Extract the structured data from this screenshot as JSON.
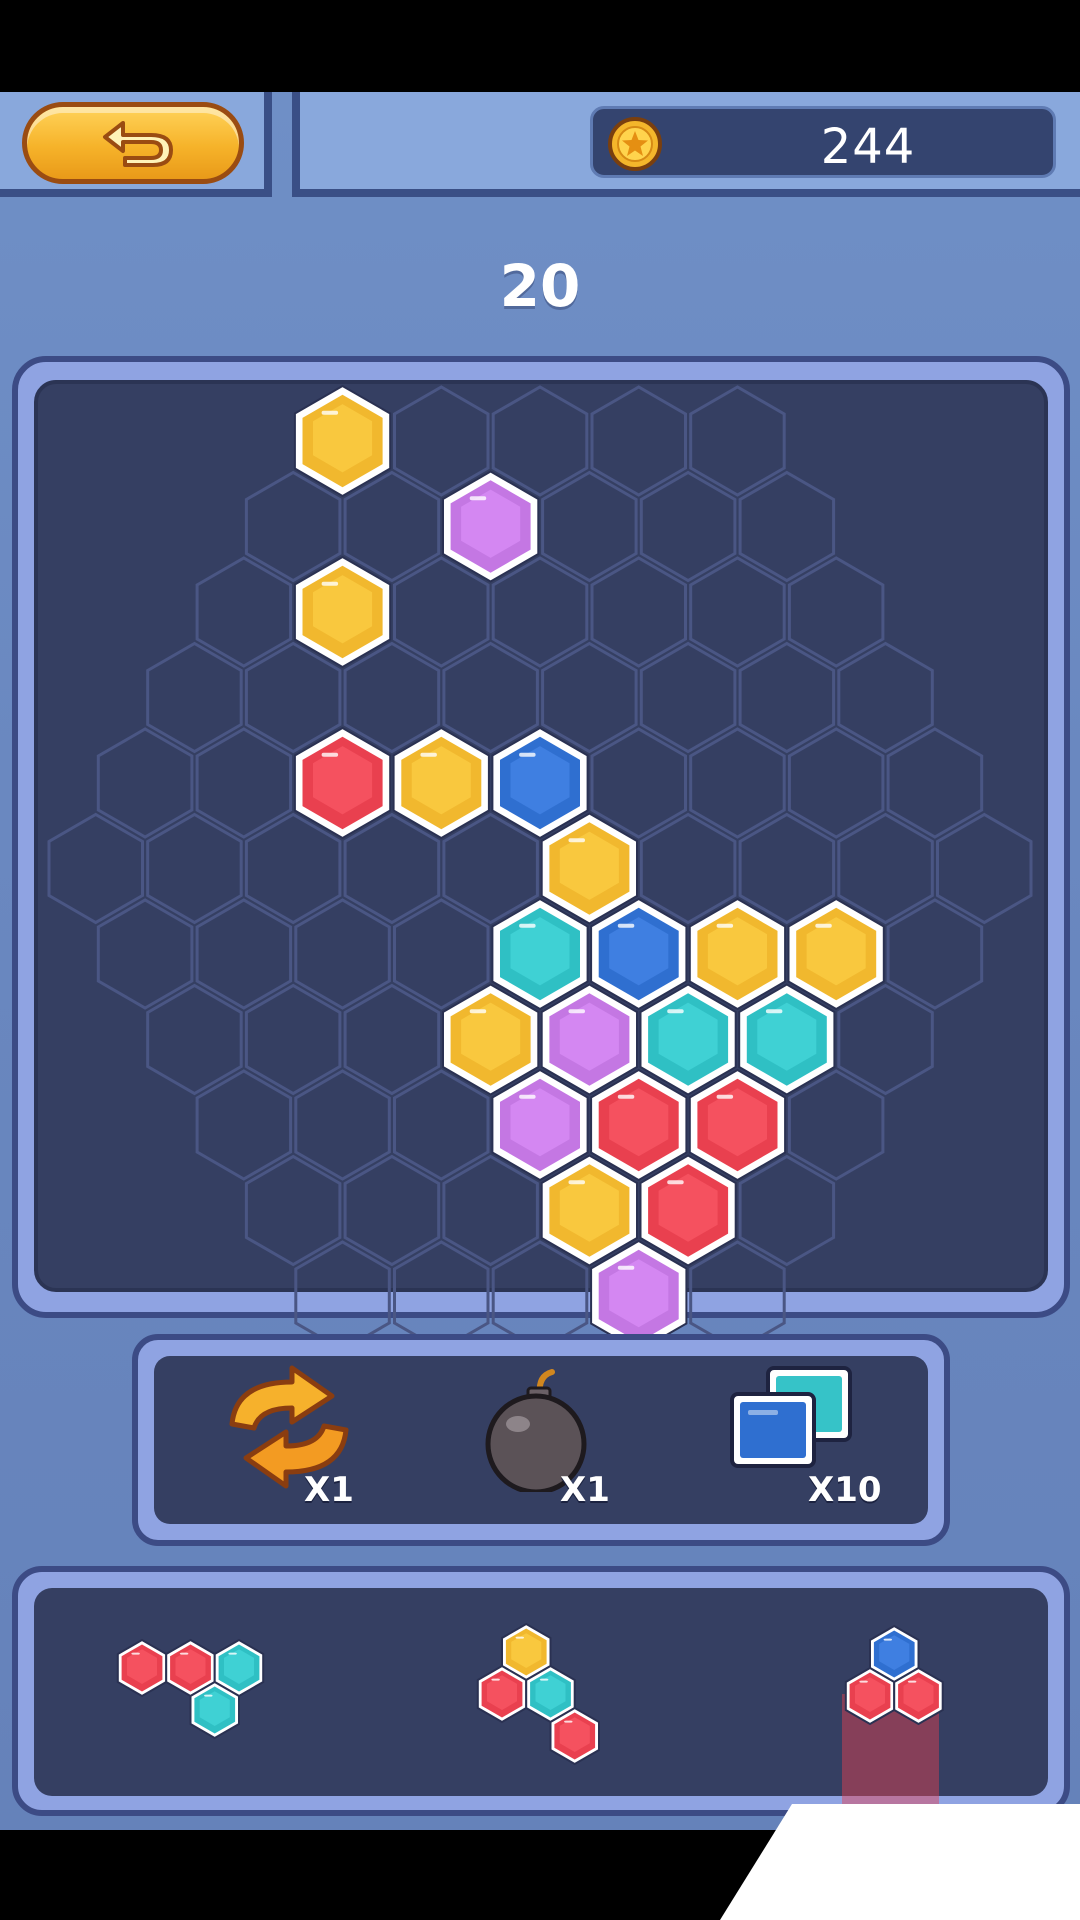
{
  "header": {
    "back_button": "back",
    "coin_icon": "coin-star-icon",
    "coins": "244"
  },
  "score": "20",
  "colors": {
    "yellow": "#f1b82e",
    "purple": "#c477e3",
    "blue": "#2f6fd0",
    "red": "#e9404f",
    "teal": "#2fc0c4"
  },
  "board": {
    "filled_cells": [
      {
        "row": 0,
        "col": 4,
        "color": "yellow"
      },
      {
        "row": 1,
        "col": 3,
        "color": "purple"
      },
      {
        "row": 2,
        "col": 5,
        "color": "yellow"
      },
      {
        "row": 4,
        "col": 4,
        "color": "blue"
      },
      {
        "row": 4,
        "col": 5,
        "color": "yellow"
      },
      {
        "row": 4,
        "col": 6,
        "color": "red"
      },
      {
        "row": 5,
        "col": 4,
        "color": "yellow"
      },
      {
        "row": 6,
        "col": 1,
        "color": "yellow"
      },
      {
        "row": 6,
        "col": 2,
        "color": "yellow"
      },
      {
        "row": 6,
        "col": 3,
        "color": "blue"
      },
      {
        "row": 6,
        "col": 4,
        "color": "teal"
      },
      {
        "row": 7,
        "col": 1,
        "color": "teal"
      },
      {
        "row": 7,
        "col": 2,
        "color": "teal"
      },
      {
        "row": 7,
        "col": 3,
        "color": "purple"
      },
      {
        "row": 7,
        "col": 4,
        "color": "yellow"
      },
      {
        "row": 8,
        "col": 1,
        "color": "red"
      },
      {
        "row": 8,
        "col": 2,
        "color": "red"
      },
      {
        "row": 8,
        "col": 3,
        "color": "purple"
      },
      {
        "row": 9,
        "col": 1,
        "color": "red"
      },
      {
        "row": 9,
        "col": 2,
        "color": "yellow"
      },
      {
        "row": 10,
        "col": 1,
        "color": "purple"
      }
    ]
  },
  "tools": [
    {
      "name": "swap-arrows-icon",
      "count": "X1"
    },
    {
      "name": "bomb-icon",
      "count": "X1"
    },
    {
      "name": "block-copy-icon",
      "count": "X10"
    }
  ],
  "tray": [
    {
      "name": "piece-1",
      "cells": [
        "red",
        "red",
        "teal",
        "teal"
      ]
    },
    {
      "name": "piece-2",
      "cells": [
        "yellow",
        "red",
        "teal",
        "red"
      ]
    },
    {
      "name": "piece-3",
      "cells": [
        "blue",
        "red",
        "red"
      ]
    }
  ]
}
